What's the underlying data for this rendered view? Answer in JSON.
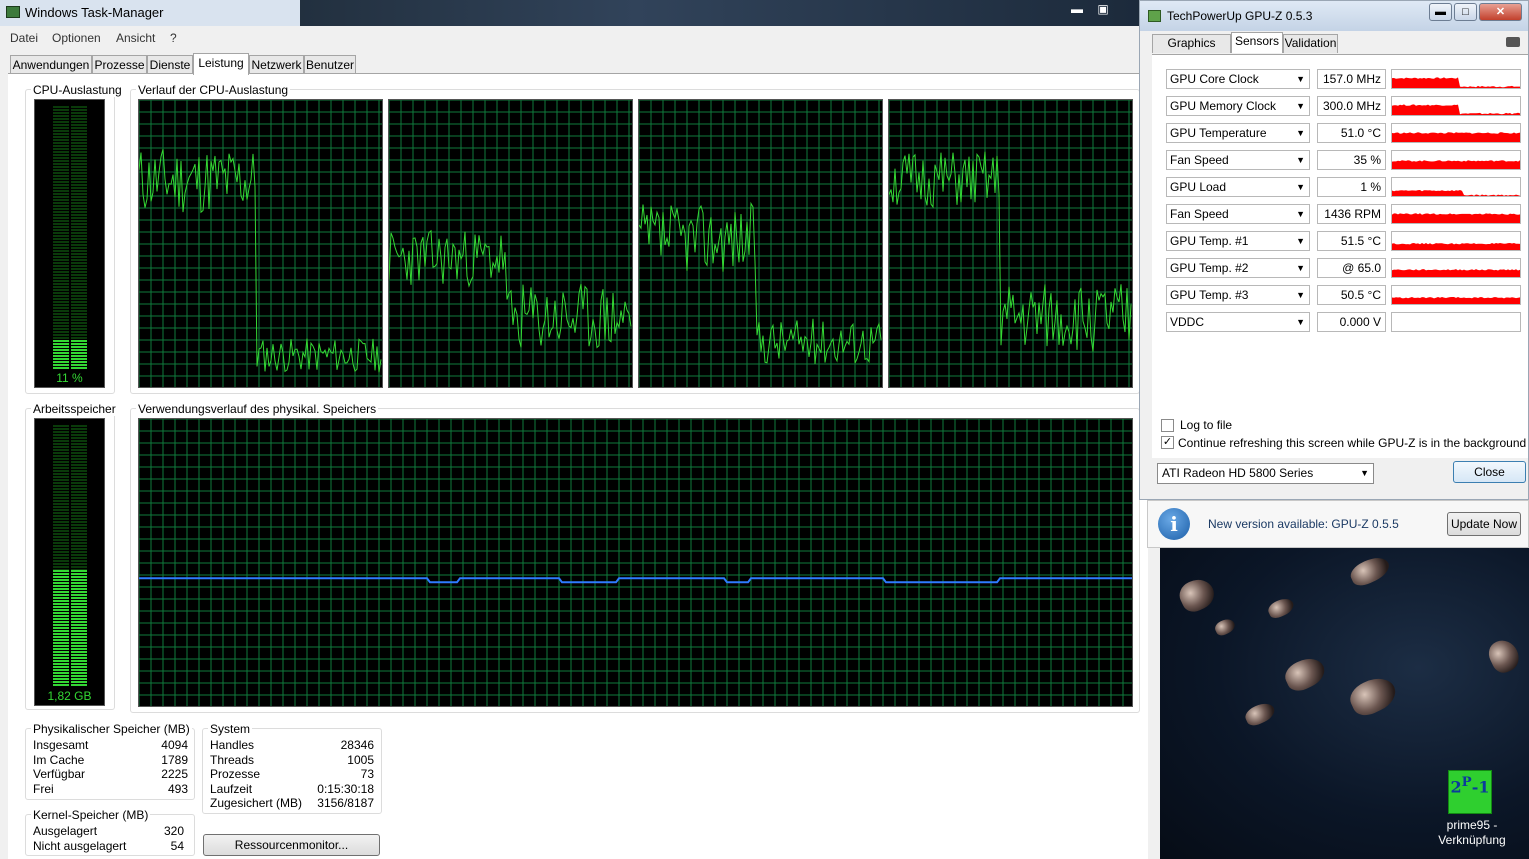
{
  "taskmanager": {
    "title": "Windows Task-Manager",
    "menu": [
      "Datei",
      "Optionen",
      "Ansicht",
      "?"
    ],
    "tabs": [
      "Anwendungen",
      "Prozesse",
      "Dienste",
      "Leistung",
      "Netzwerk",
      "Benutzer"
    ],
    "active_tab": "Leistung",
    "cpu_usage_title": "CPU-Auslastung",
    "cpu_usage_value": "11 %",
    "cpu_usage_fraction": 0.11,
    "cpu_history_title": "Verlauf der CPU-Auslastung",
    "memory_title": "Arbeitsspeicher",
    "memory_value": "1,82 GB",
    "memory_fraction": 0.445,
    "memory_history_title": "Verwendungsverlauf des physikal. Speichers",
    "physical_memory": {
      "title": "Physikalischer Speicher (MB)",
      "rows": [
        {
          "label": "Insgesamt",
          "value": "4094"
        },
        {
          "label": "Im Cache",
          "value": "1789"
        },
        {
          "label": "Verfügbar",
          "value": "2225"
        },
        {
          "label": "Frei",
          "value": "493"
        }
      ]
    },
    "kernel_memory": {
      "title": "Kernel-Speicher (MB)",
      "rows": [
        {
          "label": "Ausgelagert",
          "value": "320"
        },
        {
          "label": "Nicht ausgelagert",
          "value": "54"
        }
      ]
    },
    "system": {
      "title": "System",
      "rows": [
        {
          "label": "Handles",
          "value": "28346"
        },
        {
          "label": "Threads",
          "value": "1005"
        },
        {
          "label": "Prozesse",
          "value": "73"
        },
        {
          "label": "Laufzeit",
          "value": "0:15:30:18"
        },
        {
          "label": "Zugesichert (MB)",
          "value": "3156/8187"
        }
      ]
    },
    "resource_monitor_button": "Ressourcenmonitor..."
  },
  "gpuz": {
    "title": "TechPowerUp GPU-Z 0.5.3",
    "tabs": [
      "Graphics Card",
      "Sensors",
      "Validation"
    ],
    "active_tab": "Sensors",
    "sensors": [
      {
        "name": "GPU Core Clock",
        "value": "157.0 MHz"
      },
      {
        "name": "GPU Memory Clock",
        "value": "300.0 MHz"
      },
      {
        "name": "GPU Temperature",
        "value": "51.0 °C"
      },
      {
        "name": "Fan Speed",
        "value": "35 %"
      },
      {
        "name": "GPU Load",
        "value": "1 %"
      },
      {
        "name": "Fan Speed",
        "value": "1436 RPM"
      },
      {
        "name": "GPU Temp. #1",
        "value": "51.5 °C"
      },
      {
        "name": "GPU Temp. #2",
        "value": "@ 65.0"
      },
      {
        "name": "GPU Temp. #3",
        "value": "50.5 °C"
      },
      {
        "name": "VDDC",
        "value": "0.000 V"
      }
    ],
    "log_to_file_label": "Log to file",
    "log_to_file_checked": false,
    "continue_refresh_label": "Continue refreshing this screen while GPU-Z is in the background",
    "continue_refresh_checked": true,
    "gpu_selected": "ATI Radeon HD 5800 Series",
    "close_button": "Close",
    "notice_text": "New version available: GPU-Z 0.5.5",
    "update_button": "Update Now",
    "graph_color": "#ff0000"
  },
  "desktop": {
    "shortcut_label_line1": "prime95 -",
    "shortcut_label_line2": "Verknüpfung"
  },
  "colors": {
    "graph_green": "#34d834",
    "grid_green": "#0f7a3c",
    "memory_line": "#2f7bff"
  }
}
